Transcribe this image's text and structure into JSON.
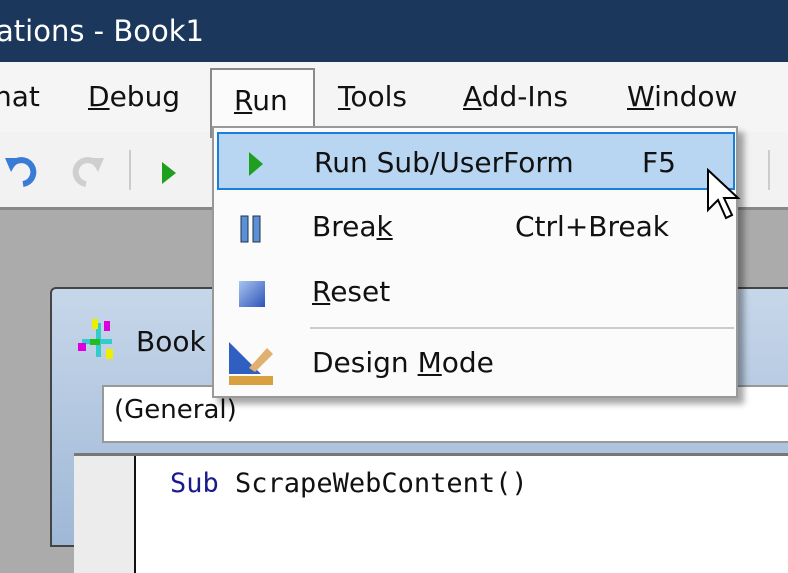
{
  "window": {
    "title": "ations - Book1"
  },
  "menubar": {
    "items": [
      {
        "label": "nat"
      },
      {
        "label": "Debug",
        "accel": "D"
      },
      {
        "label": "Run",
        "accel": "R"
      },
      {
        "label": "Tools",
        "accel": "T"
      },
      {
        "label": "Add-Ins",
        "accel": "A"
      },
      {
        "label": "Window",
        "accel": "W"
      }
    ]
  },
  "toolbar": {
    "icons": [
      "undo-icon",
      "redo-icon",
      "run-icon"
    ]
  },
  "run_menu": {
    "items": [
      {
        "label": "Run Sub/UserForm",
        "shortcut": "F5",
        "icon": "play-icon",
        "highlighted": true
      },
      {
        "label_pre": "Brea",
        "label_acc": "k",
        "label_post": "",
        "shortcut": "Ctrl+Break",
        "icon": "pause-icon"
      },
      {
        "label_pre": "",
        "label_acc": "R",
        "label_post": "eset",
        "icon": "stop-icon"
      },
      {
        "label_pre": "Design ",
        "label_acc": "M",
        "label_post": "ode",
        "icon": "design-mode-icon"
      }
    ]
  },
  "code_window": {
    "title": "Book",
    "object_combo": "(General)",
    "code_keyword": "Sub",
    "code_rest": " ScrapeWebContent()"
  },
  "colors": {
    "titlebar": "#1b385c",
    "highlight": "#b8d6f2",
    "highlight_border": "#1a7fd8",
    "keyword": "#1a1a8c"
  }
}
